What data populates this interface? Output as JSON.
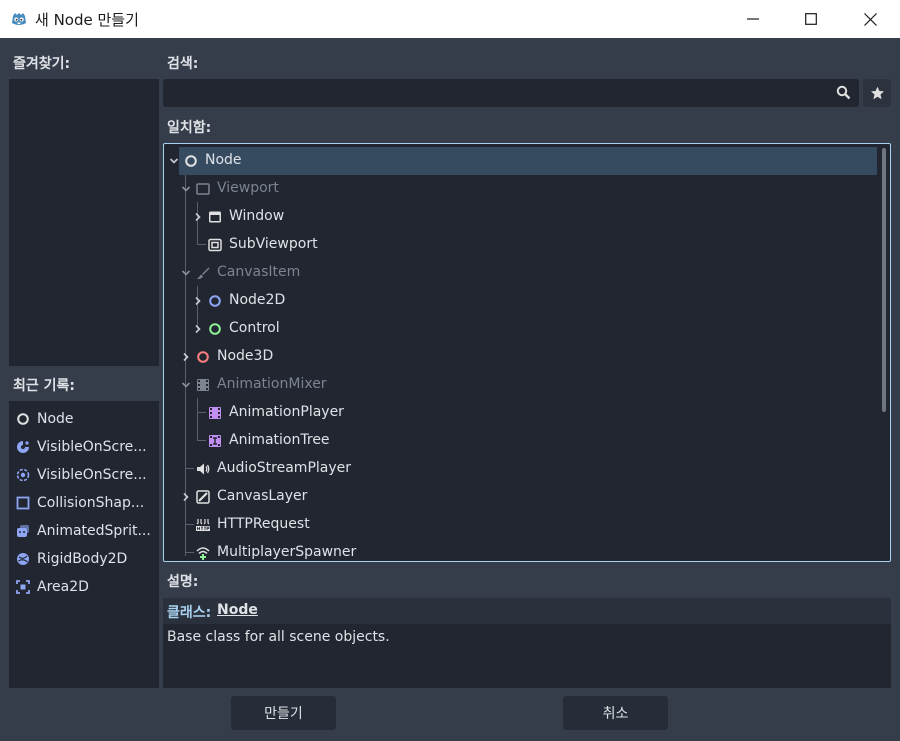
{
  "window": {
    "title": "새 Node 만들기"
  },
  "favorites": {
    "label": "즐겨찾기:"
  },
  "recent": {
    "label": "최근 기록:",
    "items": [
      {
        "label": "Node",
        "icon": "node-circle-icon"
      },
      {
        "label": "VisibleOnScre...",
        "icon": "visible-on-screen-2d-icon"
      },
      {
        "label": "VisibleOnScre...",
        "icon": "visible-on-screen-3d-icon"
      },
      {
        "label": "CollisionShap...",
        "icon": "collision-shape-icon"
      },
      {
        "label": "AnimatedSprit...",
        "icon": "animated-sprite-icon"
      },
      {
        "label": "RigidBody2D",
        "icon": "rigid-body-icon"
      },
      {
        "label": "Area2D",
        "icon": "area-2d-icon"
      }
    ]
  },
  "search": {
    "label": "검색:",
    "value": "",
    "placeholder": ""
  },
  "matches": {
    "label": "일치함:",
    "rows": [
      {
        "label": "Node",
        "icon": "node-circle-icon",
        "dim": false,
        "expanded": true,
        "selected": true
      },
      {
        "label": "Viewport",
        "icon": "viewport-icon",
        "dim": true,
        "expanded": true
      },
      {
        "label": "Window",
        "icon": "window-icon",
        "dim": false,
        "expanded": false
      },
      {
        "label": "SubViewport",
        "icon": "subviewport-icon",
        "dim": false
      },
      {
        "label": "CanvasItem",
        "icon": "canvas-item-brush-icon",
        "dim": true,
        "expanded": true
      },
      {
        "label": "Node2D",
        "icon": "node2d-circle-icon",
        "dim": false,
        "expanded": false
      },
      {
        "label": "Control",
        "icon": "control-circle-icon",
        "dim": false,
        "expanded": false
      },
      {
        "label": "Node3D",
        "icon": "node3d-circle-icon",
        "dim": false,
        "expanded": false
      },
      {
        "label": "AnimationMixer",
        "icon": "animation-mixer-icon",
        "dim": true,
        "expanded": true
      },
      {
        "label": "AnimationPlayer",
        "icon": "animation-player-icon",
        "dim": false
      },
      {
        "label": "AnimationTree",
        "icon": "animation-tree-icon",
        "dim": false
      },
      {
        "label": "AudioStreamPlayer",
        "icon": "speaker-icon",
        "dim": false
      },
      {
        "label": "CanvasLayer",
        "icon": "canvas-layer-icon",
        "dim": false,
        "expanded": false
      },
      {
        "label": "HTTPRequest",
        "icon": "http-request-icon",
        "dim": false
      },
      {
        "label": "MultiplayerSpawner",
        "icon": "multiplayer-spawner-icon",
        "dim": false
      }
    ]
  },
  "description": {
    "label": "설명:",
    "class_key": "클래스:",
    "class_name": "Node",
    "text": "Base class for all scene objects."
  },
  "buttons": {
    "create": "만들기",
    "cancel": "취소"
  },
  "colors": {
    "background": "#363d4a",
    "panel": "#212631",
    "accent": "#a9d2f0",
    "selection": "#374b60"
  }
}
